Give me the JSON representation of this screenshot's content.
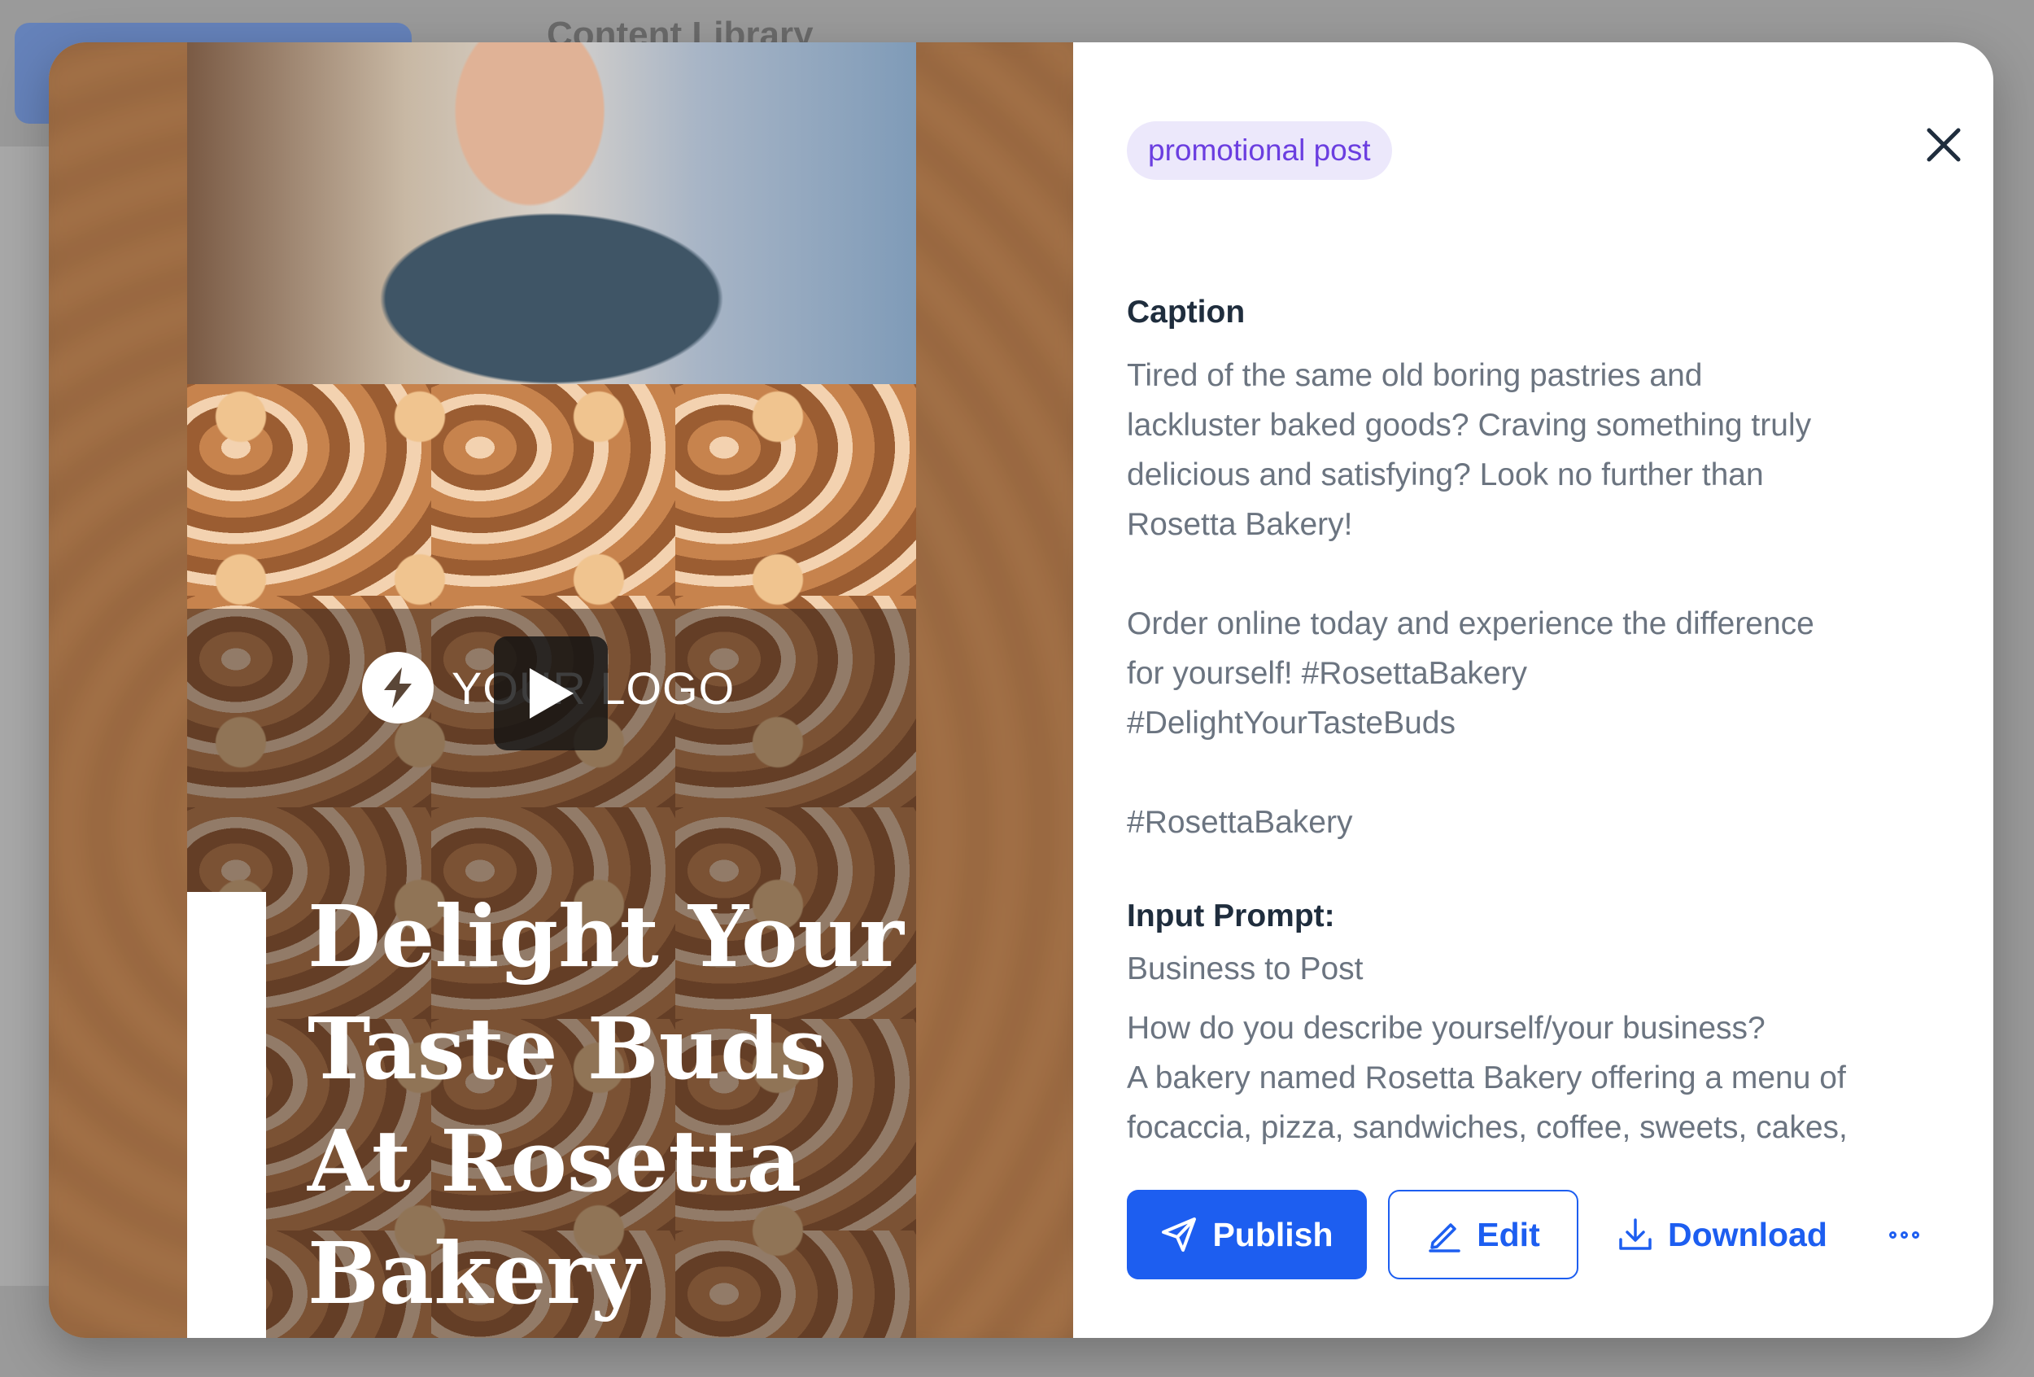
{
  "backdrop": {
    "title": "Content Library"
  },
  "media": {
    "logo_text": "YOUR LOGO",
    "headline_lines": [
      "Delight Your",
      "Taste Buds",
      "At Rosetta",
      "Bakery"
    ]
  },
  "panel": {
    "tag": "promotional post",
    "caption_label": "Caption",
    "caption_lines": [
      "Tired of the same old boring pastries and",
      "lackluster baked goods? Craving something truly",
      "delicious and satisfying? Look no further than",
      "Rosetta Bakery!",
      "",
      "Order online today and experience the difference",
      "for yourself! #RosettaBakery",
      "#DelightYourTasteBuds",
      "",
      "#RosettaBakery"
    ],
    "input_prompt_label": "Input Prompt:",
    "input_prompt_type": "Business to Post",
    "prompt_question": "How do you describe yourself/your business?",
    "prompt_answer_lines": [
      "A bakery named Rosetta Bakery offering a menu of",
      "focaccia, pizza, sandwiches, coffee, sweets, cakes,"
    ]
  },
  "actions": {
    "publish_label": "Publish",
    "edit_label": "Edit",
    "download_label": "Download"
  },
  "colors": {
    "accent": "#1d5ef0",
    "tag_bg": "#ece8fb",
    "tag_text": "#6b3ee0",
    "heading_text": "#1f2d3d",
    "body_text": "#6b7480"
  },
  "icons": {
    "close": "close-icon",
    "publish": "send-icon",
    "edit": "pencil-icon",
    "download": "download-icon",
    "more": "more-horizontal-icon",
    "logo": "bolt-icon",
    "play": "play-icon"
  }
}
